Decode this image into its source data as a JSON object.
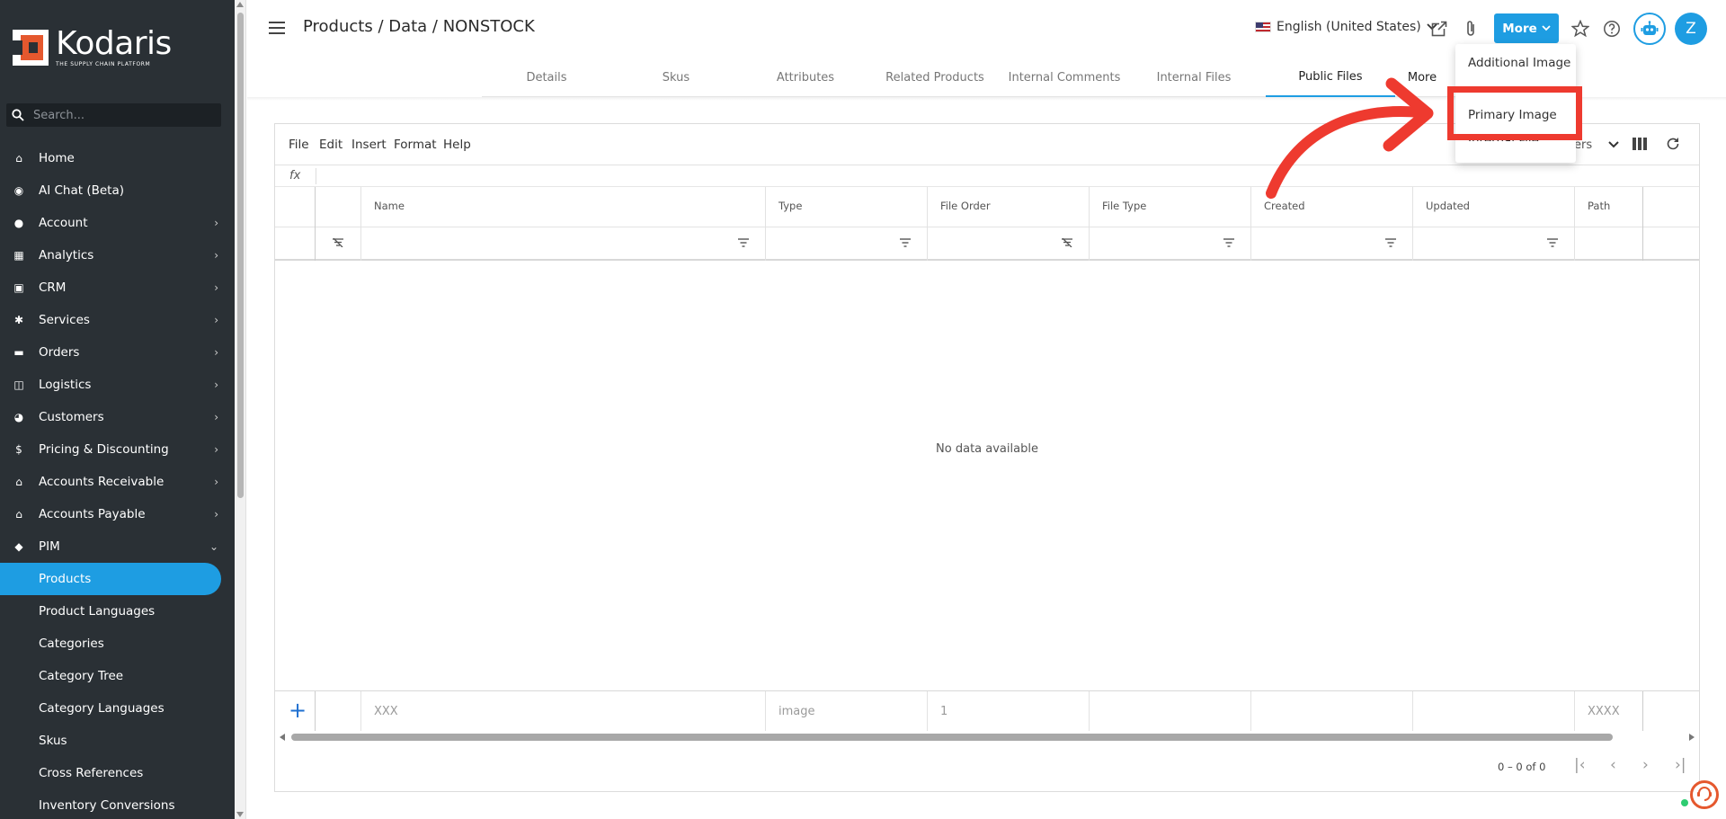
{
  "app": {
    "logo_name": "Kodaris",
    "logo_tagline": "THE SUPPLY CHAIN PLATFORM",
    "brand_color": "#1e9de2",
    "sidebar_color": "#2a3035"
  },
  "sidebar": {
    "search_placeholder": "Search...",
    "items": [
      {
        "label": "Home",
        "icon": "home-icon",
        "chevron": ""
      },
      {
        "label": "AI Chat (Beta)",
        "icon": "robot-icon",
        "chevron": ""
      },
      {
        "label": "Account",
        "icon": "user-icon",
        "chevron": "›"
      },
      {
        "label": "Analytics",
        "icon": "chart-icon",
        "chevron": "›"
      },
      {
        "label": "CRM",
        "icon": "contact-card-icon",
        "chevron": "›"
      },
      {
        "label": "Services",
        "icon": "gears-icon",
        "chevron": "›"
      },
      {
        "label": "Orders",
        "icon": "truck-icon",
        "chevron": "›"
      },
      {
        "label": "Logistics",
        "icon": "delivery-icon",
        "chevron": "›"
      },
      {
        "label": "Customers",
        "icon": "people-icon",
        "chevron": "›"
      },
      {
        "label": "Pricing & Discounting",
        "icon": "dollar-icon",
        "chevron": "›"
      },
      {
        "label": "Accounts Receivable",
        "icon": "bank-icon",
        "chevron": "›"
      },
      {
        "label": "Accounts Payable",
        "icon": "bank-icon",
        "chevron": "›"
      },
      {
        "label": "PIM",
        "icon": "tag-icon",
        "chevron": "⌄"
      }
    ],
    "sub_items": [
      {
        "label": "Products",
        "active": true
      },
      {
        "label": "Product Languages"
      },
      {
        "label": "Categories"
      },
      {
        "label": "Category Tree"
      },
      {
        "label": "Category Languages"
      },
      {
        "label": "Skus"
      },
      {
        "label": "Cross References"
      },
      {
        "label": "Inventory Conversions"
      }
    ]
  },
  "header": {
    "title": "Products / Data / NONSTOCK",
    "language": "English (United States)",
    "more_label": "More",
    "avatar_initial": "Z"
  },
  "tabs": [
    {
      "label": "Details"
    },
    {
      "label": "Skus"
    },
    {
      "label": "Attributes"
    },
    {
      "label": "Related Products"
    },
    {
      "label": "Internal Comments"
    },
    {
      "label": "Internal Files"
    },
    {
      "label": "Public Files",
      "active": true
    },
    {
      "label": "More"
    }
  ],
  "dropdown": {
    "items": [
      "Additional Image",
      "Primary Image",
      "Internal File"
    ]
  },
  "grid": {
    "menu": [
      "File",
      "Edit",
      "Insert",
      "Format",
      "Help"
    ],
    "views_label": "ers",
    "fx_label": "fx",
    "columns": [
      "Name",
      "Type",
      "File Order",
      "File Type",
      "Created",
      "Updated",
      "Path"
    ],
    "empty_message": "No data available",
    "new_row": {
      "name": "XXX",
      "type": "image",
      "file_order": "1",
      "path": "XXXX"
    },
    "pager_text": "0 – 0 of 0"
  },
  "annotation": {
    "color": "#ee3a2f"
  }
}
